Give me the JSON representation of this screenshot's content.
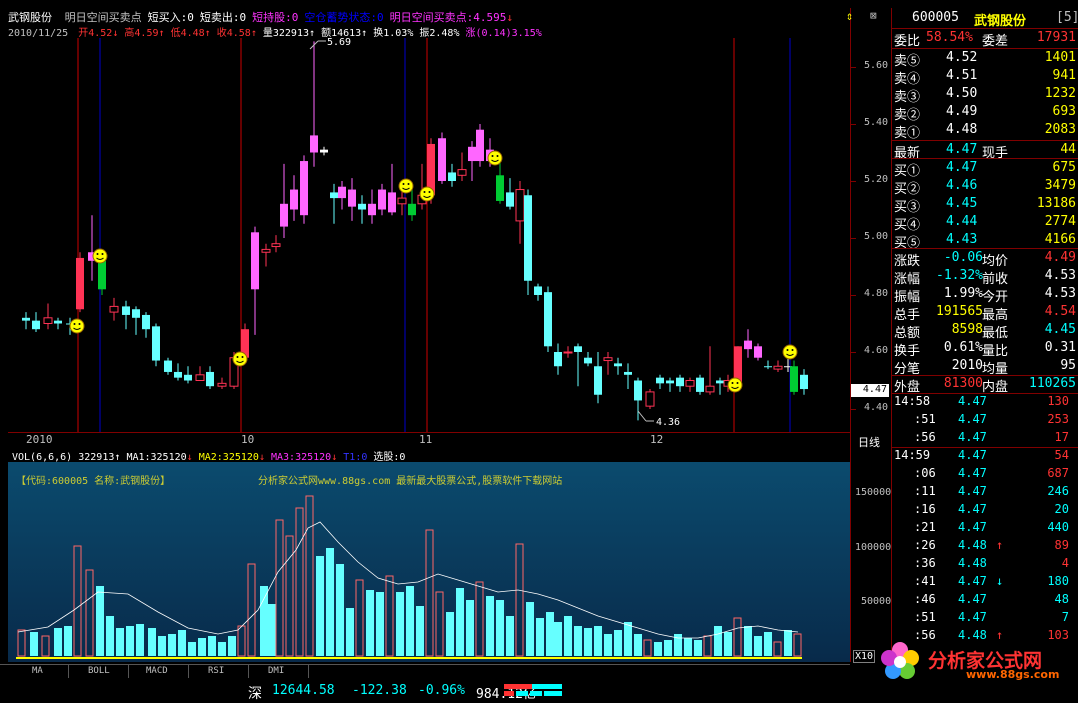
{
  "header": {
    "stock_name": "武钢股份",
    "items": [
      {
        "text": "明日空间买卖点",
        "color": "#c0c0c0"
      },
      {
        "text": "短买入:0",
        "color": "#ffffff"
      },
      {
        "text": "短卖出:0",
        "color": "#ffffff"
      },
      {
        "text": "短持股:0",
        "color": "#ff33ff"
      },
      {
        "text": "空仓蓄势状态:0",
        "color": "#0000ff"
      },
      {
        "text": "明日空间买卖点:4.595",
        "color": "#ff33ff"
      }
    ],
    "arrow": "↓"
  },
  "ohlc": {
    "date": "2010/11/25",
    "open_label": "开",
    "open": "4.52",
    "high_label": "高",
    "high": "4.59",
    "low_label": "低",
    "low": "4.48",
    "close_label": "收",
    "close": "4.58",
    "vol_label": "量",
    "vol": "322913",
    "amt_label": "额",
    "amt": "14613",
    "turn_label": "换",
    "turn": "1.03%",
    "amp_label": "振",
    "amp": "2.48%",
    "chg_label": "涨",
    "chg": "(0.14)3.15%"
  },
  "price_axis": [
    "5.60",
    "5.40",
    "5.20",
    "5.00",
    "4.80",
    "4.60",
    "4.40"
  ],
  "current_price_tag": "4.47",
  "annotations": {
    "high": "5.69",
    "low": "4.36"
  },
  "date_axis": {
    "labels": [
      "2010",
      "10",
      "11",
      "12"
    ],
    "period": "日线"
  },
  "vol_header": {
    "title": "VOL(6,6,6)",
    "vol": "322913",
    "ma1": "MA1:325120",
    "ma2": "MA2:325120",
    "ma3": "MA3:325120",
    "extra1": "T1:0",
    "extra2": "选股:0"
  },
  "vol_info": {
    "left": "【代码:600005 名称:武钢股份】",
    "right": "分析家公式网www.88gs.com 最新最大股票公式,股票软件下载网站"
  },
  "vol_axis": [
    "150000",
    "100000",
    "50000"
  ],
  "vol_unit": "X10",
  "tabs": [
    "MA",
    "BOLL",
    "MACD",
    "RSI",
    "DMI"
  ],
  "right_panel": {
    "code": "600005",
    "name": "武钢股份",
    "tab": "[5]",
    "weibi_label": "委比",
    "weibi": "58.54%",
    "weicha_label": "委差",
    "weicha": "17931",
    "sells": [
      {
        "label": "卖⑤",
        "price": "4.52",
        "vol": "1401"
      },
      {
        "label": "卖④",
        "price": "4.51",
        "vol": "941"
      },
      {
        "label": "卖③",
        "price": "4.50",
        "vol": "1232"
      },
      {
        "label": "卖②",
        "price": "4.49",
        "vol": "693"
      },
      {
        "label": "卖①",
        "price": "4.48",
        "vol": "2083"
      }
    ],
    "latest_label": "最新",
    "latest": "4.47",
    "xianshou_label": "现手",
    "xianshou": "44",
    "buys": [
      {
        "label": "买①",
        "price": "4.47",
        "vol": "675"
      },
      {
        "label": "买②",
        "price": "4.46",
        "vol": "3479"
      },
      {
        "label": "买③",
        "price": "4.45",
        "vol": "13186"
      },
      {
        "label": "买④",
        "price": "4.44",
        "vol": "2774"
      },
      {
        "label": "买⑤",
        "price": "4.43",
        "vol": "4166"
      }
    ],
    "stats": [
      {
        "l1": "涨跌",
        "v1": "-0.06",
        "l2": "均价",
        "v2": "4.49",
        "c1": "#00ffff",
        "c2": "#ff3333"
      },
      {
        "l1": "涨幅",
        "v1": "-1.32%",
        "l2": "前收",
        "v2": "4.53",
        "c1": "#00ffff",
        "c2": "#ffffff"
      },
      {
        "l1": "振幅",
        "v1": "1.99%",
        "l2": "今开",
        "v2": "4.53",
        "c1": "#ffffff",
        "c2": "#ffffff"
      },
      {
        "l1": "总手",
        "v1": "191565",
        "l2": "最高",
        "v2": "4.54",
        "c1": "#ffff00",
        "c2": "#ff3333"
      },
      {
        "l1": "总额",
        "v1": "8598",
        "l2": "最低",
        "v2": "4.45",
        "c1": "#ffff00",
        "c2": "#00ffff"
      },
      {
        "l1": "换手",
        "v1": "0.61%",
        "l2": "量比",
        "v2": "0.31",
        "c1": "#ffffff",
        "c2": "#ffffff"
      },
      {
        "l1": "分笔",
        "v1": "2010",
        "l2": "均量",
        "v2": "95",
        "c1": "#ffffff",
        "c2": "#ffffff"
      }
    ],
    "waipan_label": "外盘",
    "waipan": "81300",
    "neipan_label": "内盘",
    "neipan": "110265",
    "ticks": [
      {
        "t": "14:58",
        "p": "4.47",
        "v": "130",
        "c": "#ff3333",
        "arrow": ""
      },
      {
        "t": ":51",
        "p": "4.47",
        "v": "253",
        "c": "#ff3333",
        "arrow": ""
      },
      {
        "t": ":56",
        "p": "4.47",
        "v": "17",
        "c": "#ff3333",
        "arrow": ""
      },
      {
        "t": "14:59",
        "p": "4.47",
        "v": "54",
        "c": "#ff3333",
        "arrow": ""
      },
      {
        "t": ":06",
        "p": "4.47",
        "v": "687",
        "c": "#ff3333",
        "arrow": ""
      },
      {
        "t": ":11",
        "p": "4.47",
        "v": "246",
        "c": "#00ffff",
        "arrow": ""
      },
      {
        "t": ":16",
        "p": "4.47",
        "v": "20",
        "c": "#00ffff",
        "arrow": ""
      },
      {
        "t": ":21",
        "p": "4.47",
        "v": "440",
        "c": "#00ffff",
        "arrow": ""
      },
      {
        "t": ":26",
        "p": "4.48",
        "v": "89",
        "c": "#ff3333",
        "arrow": "↑"
      },
      {
        "t": ":36",
        "p": "4.48",
        "v": "4",
        "c": "#ff3333",
        "arrow": ""
      },
      {
        "t": ":41",
        "p": "4.47",
        "v": "180",
        "c": "#00ffff",
        "arrow": "↓"
      },
      {
        "t": ":46",
        "p": "4.47",
        "v": "48",
        "c": "#00ffff",
        "arrow": ""
      },
      {
        "t": ":51",
        "p": "4.47",
        "v": "7",
        "c": "#00ffff",
        "arrow": ""
      },
      {
        "t": ":56",
        "p": "4.48",
        "v": "103",
        "c": "#ff3333",
        "arrow": "↑"
      }
    ]
  },
  "logo": {
    "text": "分析家公式网",
    "url": "www.88gs.com"
  },
  "status": {
    "market": "深",
    "index": "12644.58",
    "change": "-122.38",
    "pct": "-0.96%",
    "amount": "984.12亿"
  }
}
